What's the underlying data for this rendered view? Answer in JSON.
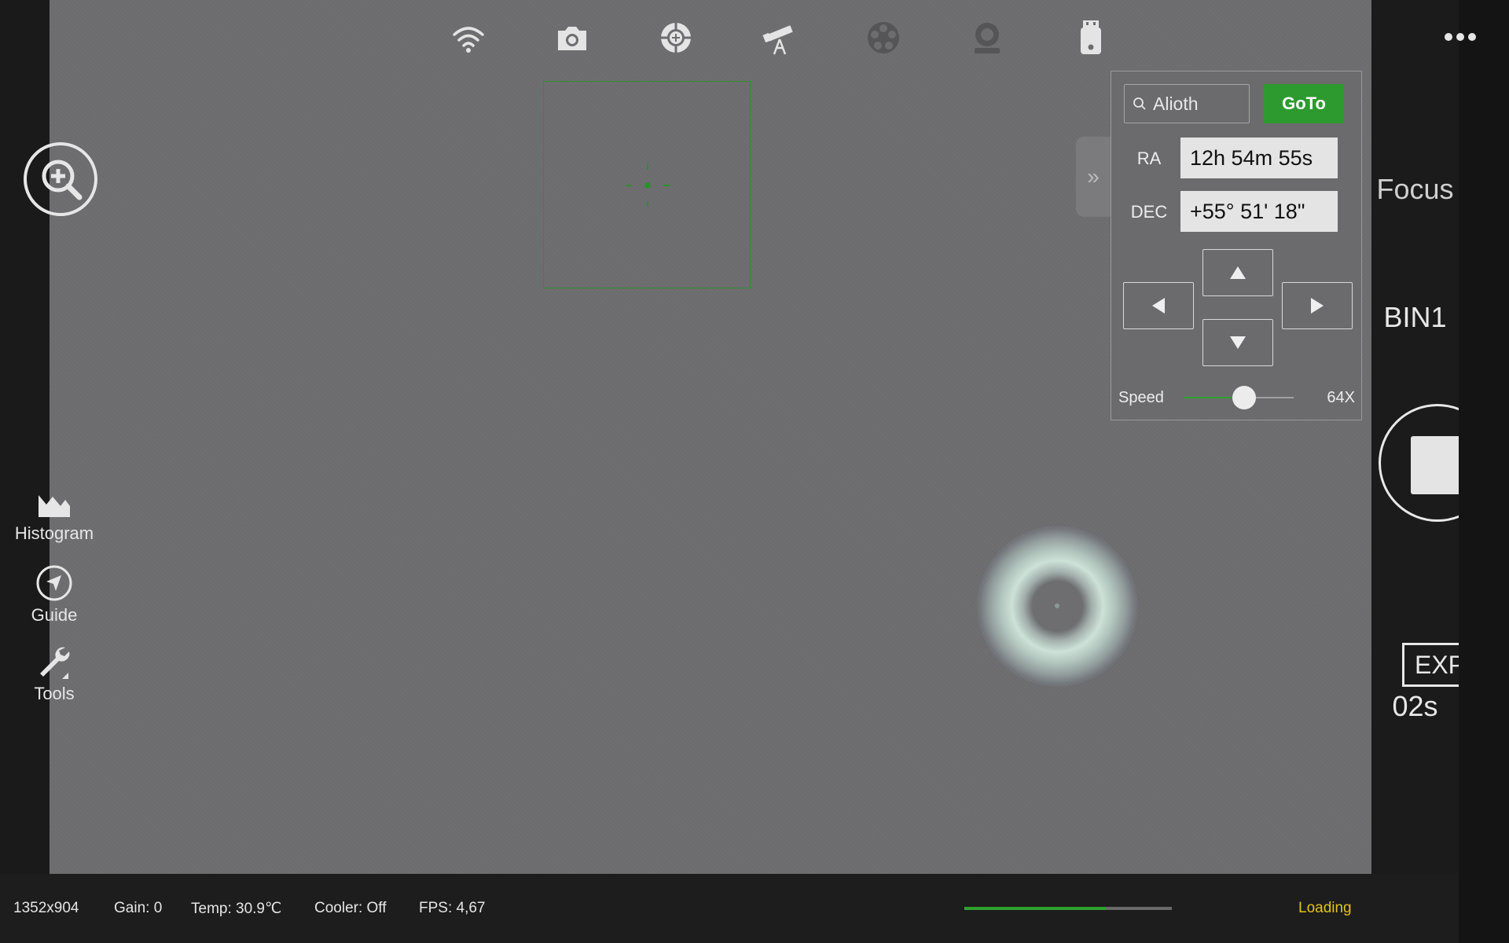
{
  "toolbar": {
    "icons": [
      "wifi-icon",
      "camera-icon",
      "crosshair-icon",
      "telescope-icon",
      "filter-wheel-icon",
      "focuser-icon",
      "usb-drive-icon"
    ]
  },
  "left_tools": {
    "zoom_icon": "zoom-in-icon",
    "histogram_label": "Histogram",
    "guide_label": "Guide",
    "tools_label": "Tools"
  },
  "goto_panel": {
    "search_value": "Alioth",
    "goto_label": "GoTo",
    "ra_label": "RA",
    "ra_value": "12h 54m 55s",
    "dec_label": "DEC",
    "dec_value": "+55° 51' 18\"",
    "speed_label": "Speed",
    "speed_value": "64X",
    "speed_slider_fraction": 0.55,
    "collapse_glyph": "»"
  },
  "right_rail": {
    "focus_label": "Focus",
    "bin_label": "BIN1",
    "exp_label": "EXP",
    "exp_value": "02s"
  },
  "status": {
    "resolution": "1352x904",
    "gain": "Gain: 0",
    "temp": "Temp: 30.9℃",
    "cooler": "Cooler: Off",
    "fps": "FPS: 4,67",
    "progress_fraction": 0.68,
    "loading": "Loading"
  },
  "colors": {
    "accent_green": "#2d9a2f",
    "loading_yellow": "#e2c21c"
  }
}
